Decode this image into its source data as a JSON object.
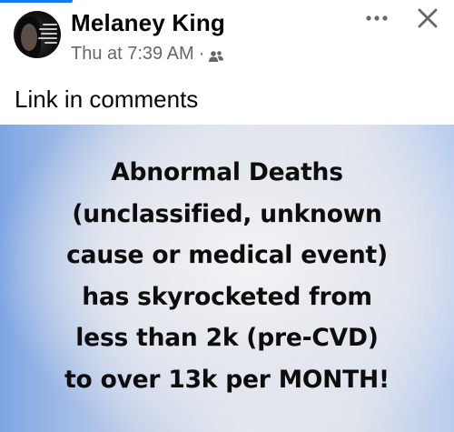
{
  "post": {
    "author": "Melaney King",
    "timestamp": "Thu at 7:39 AM",
    "separator": "·",
    "audience_icon": "friends-icon",
    "text": "Link in comments",
    "more_icon": "more-icon",
    "close_icon": "close-icon"
  },
  "image": {
    "lines": [
      "Abnormal Deaths",
      "(unclassified, unknown",
      "cause or medical event)",
      "has skyrocketed from",
      "less than 2k (pre-CVD)",
      "to over 13k per MONTH!"
    ]
  },
  "colors": {
    "accent": "#1877f2",
    "name": "#050505",
    "meta": "#65676b"
  }
}
